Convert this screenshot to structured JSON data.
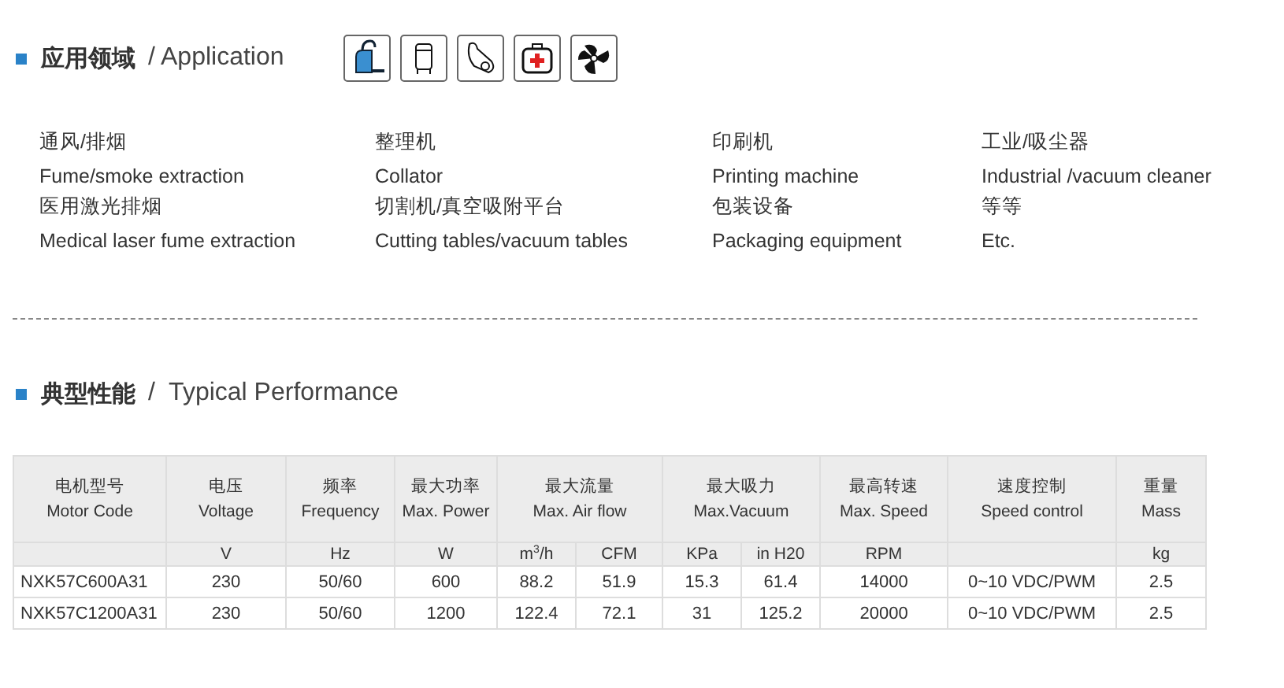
{
  "application": {
    "title_cn": "应用领域",
    "title_en": "/ Application",
    "items": [
      {
        "cn": "通风/排烟",
        "en": "Fume/smoke extraction"
      },
      {
        "cn": "整理机",
        "en": "Collator"
      },
      {
        "cn": "印刷机",
        "en": "Printing machine"
      },
      {
        "cn": "工业/吸尘器",
        "en": "Industrial /vacuum cleaner"
      },
      {
        "cn": "医用激光排烟",
        "en": "Medical laser fume extraction"
      },
      {
        "cn": "切割机/真空吸附平台",
        "en": "Cutting tables/vacuum tables"
      },
      {
        "cn": "包装设备",
        "en": "Packaging equipment"
      },
      {
        "cn": "等等",
        "en": "Etc."
      }
    ]
  },
  "performance": {
    "title_cn": "典型性能",
    "title_en": "/  Typical Performance",
    "header_groups": [
      {
        "cn": "电机型号",
        "en": "Motor Code"
      },
      {
        "cn": "电压",
        "en": "Voltage",
        "units": [
          "V"
        ]
      },
      {
        "cn": "频率",
        "en": "Frequency",
        "units": [
          "Hz"
        ]
      },
      {
        "cn": "最大功率",
        "en": "Max. Power",
        "units": [
          "W"
        ]
      },
      {
        "cn": "最大流量",
        "en": "Max. Air flow",
        "units": [
          "m$^{3}$/h",
          "CFM"
        ]
      },
      {
        "cn": "最大吸力",
        "en": "Max.Vacuum",
        "units": [
          "KPa",
          "in H20"
        ]
      },
      {
        "cn": "最高转速",
        "en": "Max. Speed",
        "units": [
          "RPM"
        ]
      },
      {
        "cn": "速度控制",
        "en": "Speed control"
      },
      {
        "cn": "重量",
        "en": "Mass",
        "units": [
          "kg"
        ]
      }
    ],
    "rows": [
      [
        "NXK57C600A31",
        "230",
        "50/60",
        "600",
        "88.2",
        "51.9",
        "15.3",
        "61.4",
        "14000",
        "0~10 VDC/PWM",
        "2.5"
      ],
      [
        "NXK57C1200A31",
        "230",
        "50/60",
        "1200",
        "122.4",
        "72.1",
        "31",
        "125.2",
        "20000",
        "0~10 VDC/PWM",
        "2.5"
      ]
    ]
  }
}
